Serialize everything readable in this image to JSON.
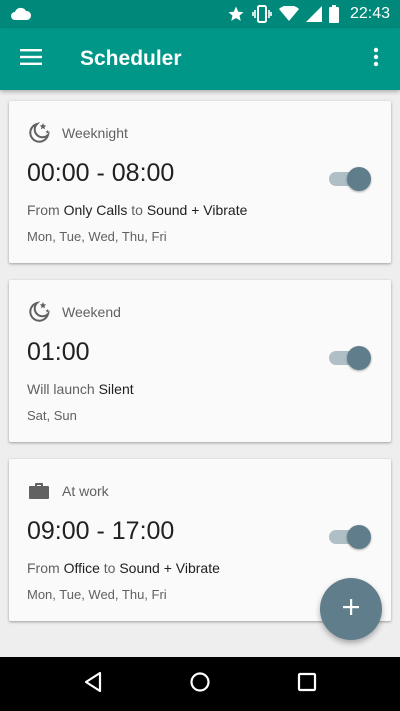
{
  "status_bar": {
    "time": "22:43",
    "icons": [
      "cloud-icon",
      "star-icon",
      "vibrate-icon",
      "wifi-icon",
      "signal-icon",
      "battery-icon"
    ]
  },
  "app_bar": {
    "title": "Scheduler",
    "menu_icon": "menu-icon",
    "overflow_icon": "more-vert-icon"
  },
  "cards": [
    {
      "icon": "moon-stars-icon",
      "name": "Weeknight",
      "time": "00:00 - 08:00",
      "desc_parts": [
        "From ",
        "Only Calls",
        " to ",
        "Sound + Vibrate"
      ],
      "days": "Mon, Tue, Wed, Thu, Fri",
      "enabled": true
    },
    {
      "icon": "moon-stars-icon",
      "name": "Weekend",
      "time": "01:00",
      "desc_parts": [
        "Will launch ",
        "Silent"
      ],
      "days": "Sat, Sun",
      "enabled": true
    },
    {
      "icon": "briefcase-icon",
      "name": "At work",
      "time": "09:00 - 17:00",
      "desc_parts": [
        "From ",
        "Office",
        " to ",
        "Sound + Vibrate"
      ],
      "days": "Mon, Tue, Wed, Thu, Fri",
      "enabled": true
    }
  ],
  "fab": {
    "icon": "plus-icon",
    "label": "+"
  },
  "nav": {
    "back": "back-icon",
    "home": "home-icon",
    "recents": "recents-icon"
  },
  "colors": {
    "status_bar": "#00897b",
    "app_bar": "#009688",
    "accent": "#607d8b",
    "toggle_track": "#b0bec5",
    "background": "#eeeeee"
  }
}
